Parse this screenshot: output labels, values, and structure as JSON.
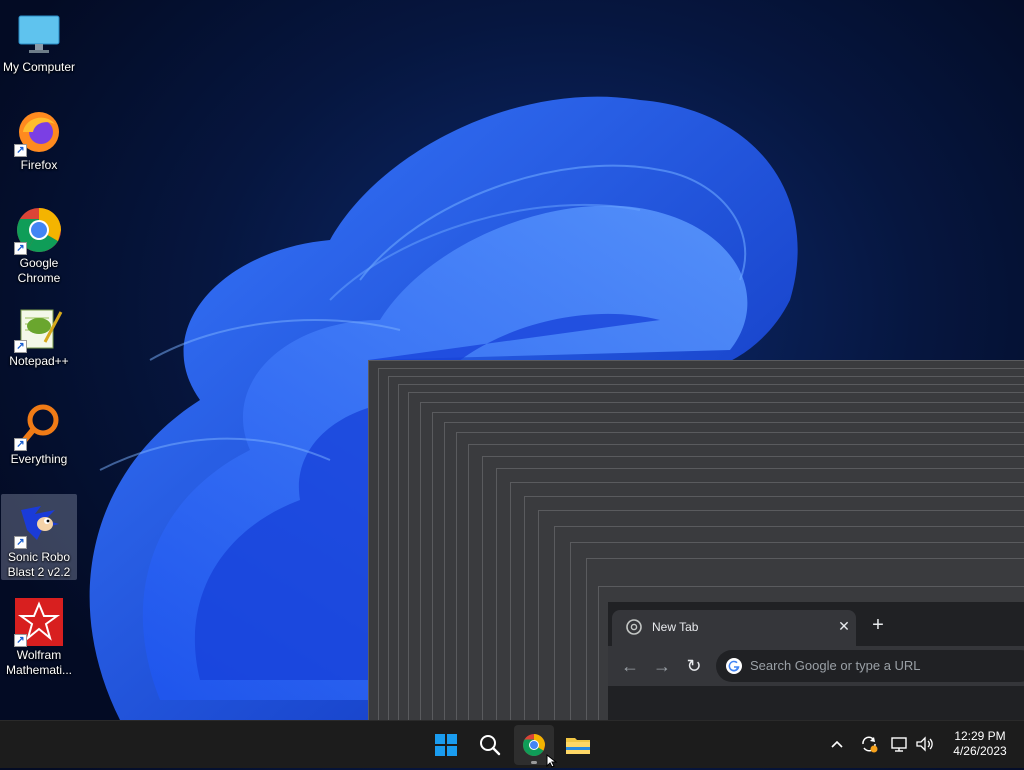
{
  "desktop": {
    "icons": [
      {
        "label": "My Computer"
      },
      {
        "label": "Firefox"
      },
      {
        "label": "Google\nChrome"
      },
      {
        "label": "Notepad++"
      },
      {
        "label": "Everything"
      },
      {
        "label": "Sonic Robo\nBlast 2 v2.2"
      },
      {
        "label": "Wolfram\nMathemati..."
      }
    ]
  },
  "chrome": {
    "tab_title": "New Tab",
    "tab_close": "✕",
    "new_tab": "+",
    "omnibox_placeholder": "Search Google or type a URL",
    "back": "←",
    "forward": "→",
    "reload": "↻"
  },
  "taskbar": {
    "clock_time": "12:29 PM",
    "clock_date": "4/26/2023",
    "apps": [
      "start-icon",
      "search-icon",
      "chrome-icon",
      "file-explorer-icon"
    ],
    "tray_chevron": "^"
  },
  "colors": {
    "accent": "#0b6cff",
    "taskbar_bg": "#1c1c1c",
    "chrome_dark": "#202124"
  }
}
